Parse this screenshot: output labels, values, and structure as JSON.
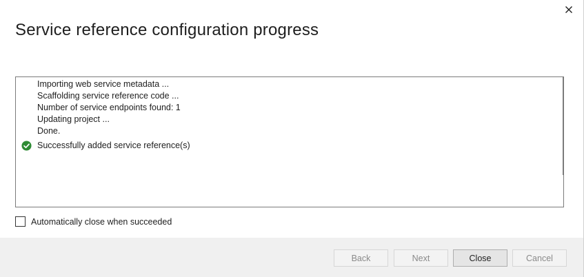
{
  "dialog": {
    "title": "Service reference configuration progress",
    "close_icon": "close-icon"
  },
  "log": {
    "lines": [
      "Importing web service metadata ...",
      "Scaffolding service reference code ...",
      "Number of service endpoints found: 1",
      "Updating project ...",
      "Done."
    ],
    "success": {
      "icon": "success-check-icon",
      "text": "Successfully added service reference(s)",
      "color": "#2e8b34"
    }
  },
  "options": {
    "auto_close_label": "Automatically close when succeeded",
    "auto_close_checked": false
  },
  "buttons": {
    "back": "Back",
    "next": "Next",
    "close": "Close",
    "cancel": "Cancel"
  }
}
